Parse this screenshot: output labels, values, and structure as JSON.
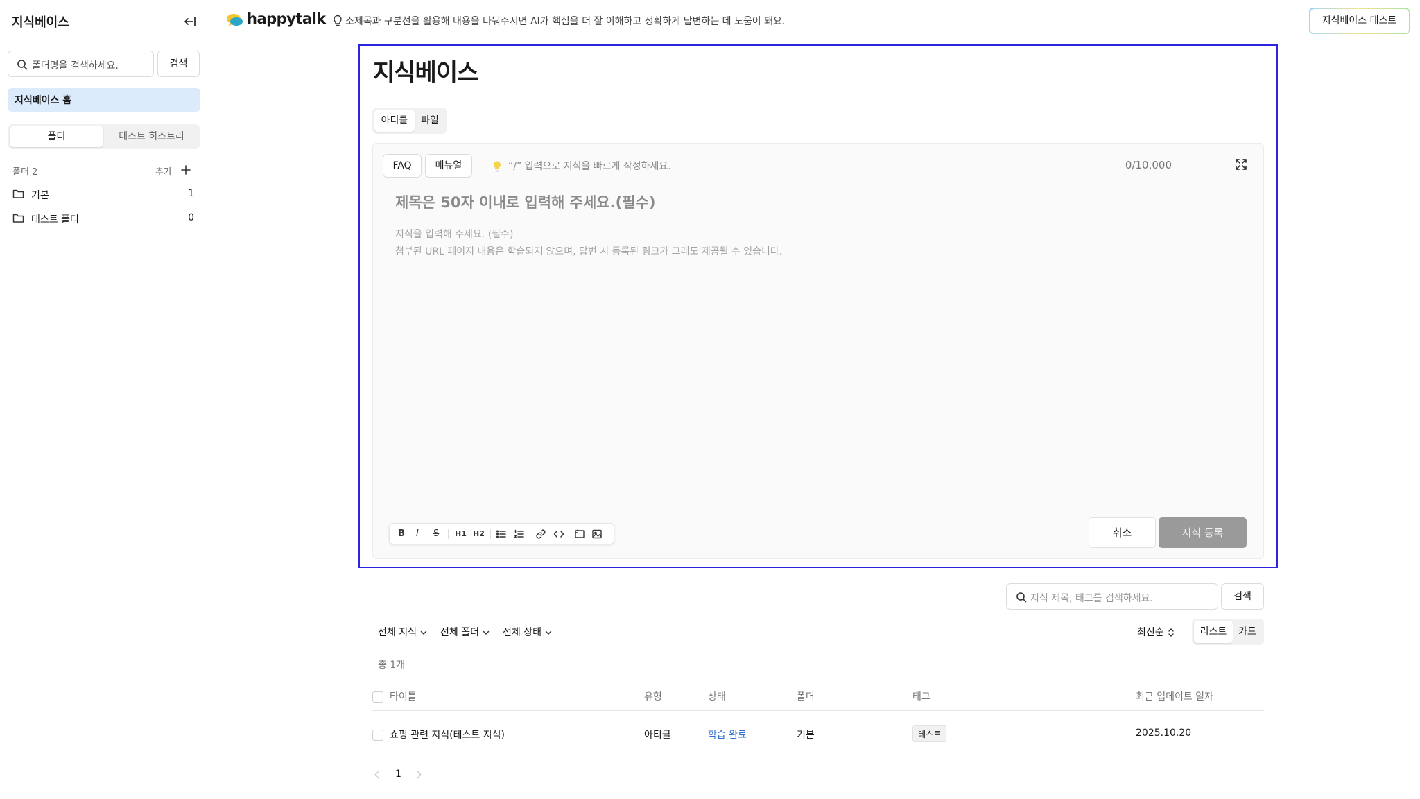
{
  "sidebar": {
    "title": "지식베이스",
    "search_placeholder": "폴더명을 검색하세요.",
    "search_button": "검색",
    "home_label": "지식베이스 홈",
    "tabs": [
      {
        "label": "폴더",
        "active": true
      },
      {
        "label": "테스트 히스토리",
        "active": false
      }
    ],
    "folder_header": "폴더 2",
    "add_label": "추가",
    "folders": [
      {
        "name": "기본",
        "count": "1"
      },
      {
        "name": "테스트 폴더",
        "count": "0"
      }
    ]
  },
  "topbar": {
    "logo_text": "happytalk",
    "tip": "소제목과 구분선을 활용해 내용을 나눠주시면 AI가 핵심을 더 잘 이해하고 정확하게 답변하는 데 도움이 돼요.",
    "test_button": "지식베이스 테스트"
  },
  "editor": {
    "page_title": "지식베이스",
    "tabs": [
      {
        "label": "아티클",
        "active": true
      },
      {
        "label": "파일",
        "active": false
      }
    ],
    "types": [
      "FAQ",
      "매뉴얼"
    ],
    "slash_hint": "“/” 입력으로 지식을 빠르게 작성하세요.",
    "char_count": "0/10,000",
    "title_placeholder": "제목은 50자 이내로 입력해 주세요.(필수)",
    "body_placeholder_1": "지식을 입력해 주세요. (필수)",
    "body_placeholder_2": "첨부된 URL 페이지 내용은 학습되지 않으며, 답변 시 등록된 링크가 그래도 제공될 수 있습니다.",
    "toolbar": {
      "bold": "B",
      "italic": "I",
      "strike": "S",
      "h1": "H1",
      "h2": "H2"
    },
    "cancel_button": "취소",
    "submit_button": "지식 등록"
  },
  "list": {
    "search_placeholder": "지식 제목, 태그를 검색하세요.",
    "search_button": "검색",
    "filters": [
      "전체 지식",
      "전체 폴더",
      "전체 상태"
    ],
    "sort": "최신순",
    "views": [
      {
        "label": "리스트",
        "active": true
      },
      {
        "label": "카드",
        "active": false
      }
    ],
    "total": "총 1개",
    "columns": [
      "타이틀",
      "유형",
      "상태",
      "폴더",
      "태그",
      "최근 업데이트 일자"
    ],
    "rows": [
      {
        "title": "쇼핑 관련 지식(테스트 지식)",
        "type": "아티클",
        "status": "학습 완료",
        "folder": "기본",
        "tag": "테스트",
        "updated": "2025.10.20"
      }
    ],
    "page": "1"
  },
  "colors": {
    "accent": "#2d24e3",
    "status_blue": "#2f6fd0",
    "home_bg": "#dcebfb",
    "submit_disabled": "#9a9a9a"
  }
}
